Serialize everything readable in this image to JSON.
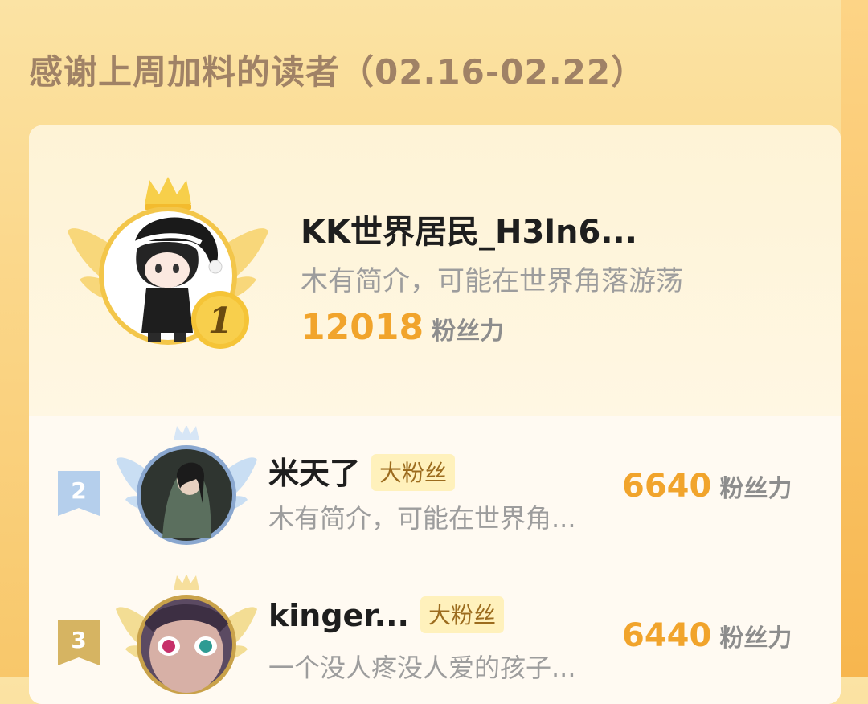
{
  "page": {
    "title": "感谢上周加料的读者（02.16-02.22）"
  },
  "top": {
    "rank": "1",
    "name": "KK世界居民_H3ln6...",
    "bio": "木有简介，可能在世界角落游荡",
    "score": "12018",
    "unit": "粉丝力"
  },
  "rows": [
    {
      "rank": "2",
      "name": "米天了",
      "badge": "大粉丝",
      "bio": "木有简介，可能在世界角...",
      "score": "6640",
      "unit": "粉丝力"
    },
    {
      "rank": "3",
      "name": "kinger...",
      "badge": "大粉丝",
      "bio": "一个没人疼没人爱的孩子...",
      "score": "6440",
      "unit": "粉丝力"
    }
  ],
  "colors": {
    "accent": "#f1a42c",
    "gold": "#f5c437",
    "silver": "#a9c7e8",
    "bronze": "#d6b462",
    "title": "#a08266"
  },
  "icons": {
    "crown": "crown-icon",
    "wings": "wings-icon",
    "rank_medal": "medal-icon",
    "rank_ribbon": "ribbon-badge-icon"
  }
}
